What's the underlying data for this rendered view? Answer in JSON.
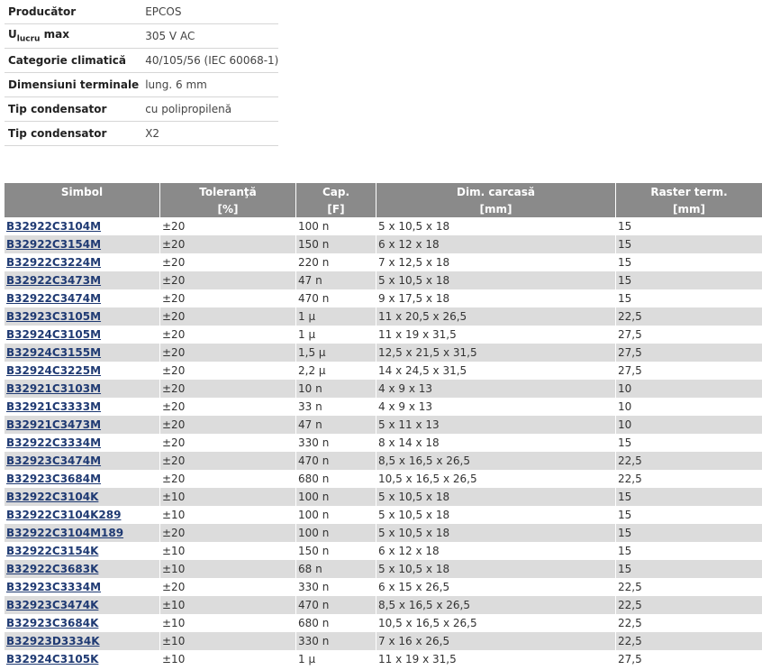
{
  "spec": [
    {
      "key": "Producător",
      "value": "EPCOS"
    },
    {
      "key": "U",
      "key_sub": "lucru",
      "key_suffix": " max",
      "value": "305 V AC"
    },
    {
      "key": "Categorie climatică",
      "value": "40/105/56 (IEC 60068-1)"
    },
    {
      "key": "Dimensiuni terminale",
      "value": "lung. 6 mm"
    },
    {
      "key": "Tip condensator",
      "value": "cu polipropilenă"
    },
    {
      "key": "Tip condensator",
      "value": "X2"
    }
  ],
  "table": {
    "headers": [
      "Simbol",
      "Toleranţă",
      "Cap.",
      "Dim. carcasă",
      "Raster term."
    ],
    "units": [
      "",
      "[%]",
      "[F]",
      "[mm]",
      "[mm]"
    ],
    "rows": [
      [
        "B32922C3104M",
        "±20",
        "100 n",
        "5 x 10,5 x 18",
        "15"
      ],
      [
        "B32922C3154M",
        "±20",
        "150 n",
        "6 x 12 x 18",
        "15"
      ],
      [
        "B32922C3224M",
        "±20",
        "220 n",
        "7 x 12,5 x 18",
        "15"
      ],
      [
        "B32922C3473M",
        "±20",
        "47 n",
        "5 x 10,5 x 18",
        "15"
      ],
      [
        "B32922C3474M",
        "±20",
        "470 n",
        "9 x 17,5 x 18",
        "15"
      ],
      [
        "B32923C3105M",
        "±20",
        "1 µ",
        "11 x 20,5 x 26,5",
        "22,5"
      ],
      [
        "B32924C3105M",
        "±20",
        "1 µ",
        "11 x 19 x 31,5",
        "27,5"
      ],
      [
        "B32924C3155M",
        "±20",
        "1,5 µ",
        "12,5 x 21,5 x 31,5",
        "27,5"
      ],
      [
        "B32924C3225M",
        "±20",
        "2,2 µ",
        "14 x 24,5 x 31,5",
        "27,5"
      ],
      [
        "B32921C3103M",
        "±20",
        "10 n",
        "4 x 9 x 13",
        "10"
      ],
      [
        "B32921C3333M",
        "±20",
        "33 n",
        "4 x 9 x 13",
        "10"
      ],
      [
        "B32921C3473M",
        "±20",
        "47 n",
        "5 x 11 x 13",
        "10"
      ],
      [
        "B32922C3334M",
        "±20",
        "330 n",
        "8 x 14 x 18",
        "15"
      ],
      [
        "B32923C3474M",
        "±20",
        "470 n",
        "8,5 x 16,5 x 26,5",
        "22,5"
      ],
      [
        "B32923C3684M",
        "±20",
        "680 n",
        "10,5 x 16,5 x 26,5",
        "22,5"
      ],
      [
        "B32922C3104K",
        "±10",
        "100 n",
        "5 x 10,5 x 18",
        "15"
      ],
      [
        "B32922C3104K289",
        "±10",
        "100 n",
        "5 x 10,5 x 18",
        "15"
      ],
      [
        "B32922C3104M189",
        "±20",
        "100 n",
        "5 x 10,5 x 18",
        "15"
      ],
      [
        "B32922C3154K",
        "±10",
        "150 n",
        "6 x 12 x 18",
        "15"
      ],
      [
        "B32922C3683K",
        "±10",
        "68 n",
        "5 x 10,5 x 18",
        "15"
      ],
      [
        "B32923C3334M",
        "±20",
        "330 n",
        "6 x 15 x 26,5",
        "22,5"
      ],
      [
        "B32923C3474K",
        "±10",
        "470 n",
        "8,5 x 16,5 x 26,5",
        "22,5"
      ],
      [
        "B32923C3684K",
        "±10",
        "680 n",
        "10,5 x 16,5 x 26,5",
        "22,5"
      ],
      [
        "B32923D3334K",
        "±10",
        "330 n",
        "7 x 16 x 26,5",
        "22,5"
      ],
      [
        "B32924C3105K",
        "±10",
        "1 µ",
        "11 x 19 x 31,5",
        "27,5"
      ]
    ]
  },
  "colors": {
    "header_bg": "#8a8a8a",
    "alt_row_bg": "#dcdcdc",
    "link": "#1f3a73"
  }
}
